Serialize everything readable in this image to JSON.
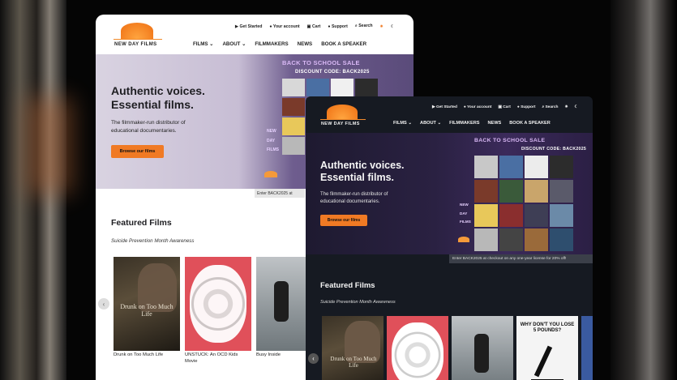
{
  "topbar": {
    "get_started": "Get Started",
    "account": "Your account",
    "cart": "Cart",
    "support": "Support",
    "search": "Search"
  },
  "logo": {
    "text": "NEW DAY FILMS"
  },
  "nav": {
    "films": "FILMS",
    "about": "ABOUT",
    "filmmakers": "FILMMAKERS",
    "news": "NEWS",
    "book": "BOOK A SPEAKER"
  },
  "hero": {
    "headline_1": "Authentic voices.",
    "headline_2": "Essential films.",
    "sub_1": "The filmmaker-run distributor of",
    "sub_2": "educational documentaries.",
    "button": "Browse our films",
    "sale_title": "BACK TO SCHOOL SALE",
    "sale_code": "DISCOUNT CODE: BACK2025",
    "side_words": [
      "NEW",
      "DAY",
      "FILMS"
    ]
  },
  "promo": {
    "light": "Enter BACK2025 at",
    "dark": "Enter BACK2025 at checkout on any one-year license for 20% off!"
  },
  "featured": {
    "title": "Featured Films",
    "subtitle": "Suicide Prevention Month Awareness",
    "films": [
      {
        "title": "Drunk on Too Much Life",
        "poster_text": "Drunk on Too Much Life"
      },
      {
        "title": "UNSTUCK: An OCD Kids Movie",
        "poster_text": ""
      },
      {
        "title": "Busy Inside",
        "poster_text": ""
      },
      {
        "title": "",
        "poster_text": "WHY DON'T YOU LOSE 5 POUNDS?"
      }
    ]
  },
  "colors": {
    "accent": "#f07a24",
    "sale_purple": "#5a4b7a",
    "dark_bg": "#161a22"
  },
  "icons": [
    "play-icon",
    "user-icon",
    "cart-icon",
    "support-icon",
    "search-icon",
    "sun-icon",
    "moon-icon",
    "chevron-down-icon",
    "chevron-left-icon",
    "chevron-right-icon"
  ]
}
